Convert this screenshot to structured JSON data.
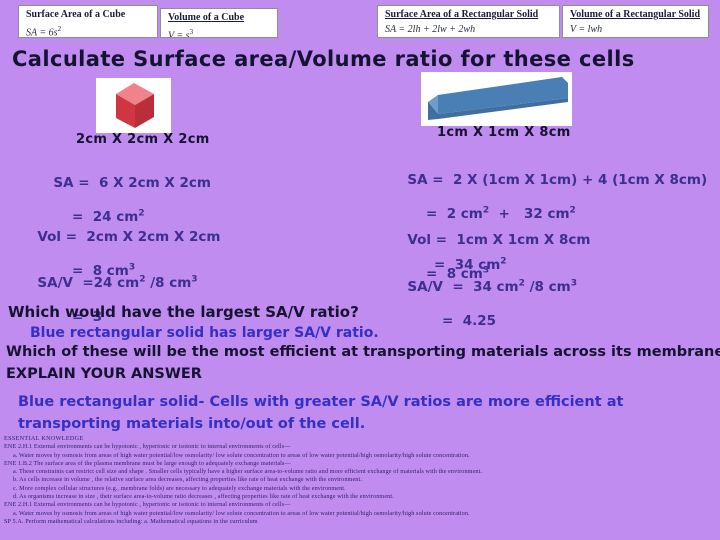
{
  "formula_boxes": [
    {
      "title": "Surface Area of a Cube",
      "equation": "SA = 6s",
      "exponent": "2",
      "underlined": false
    },
    {
      "title": "Volume of a Cube",
      "equation": "V = s",
      "exponent": "3",
      "underlined": true
    },
    {
      "title": "Surface Area of a Rectangular Solid",
      "equation": "SA = 2lh + 2lw + 2wh",
      "exponent": "",
      "underlined": true
    },
    {
      "title": "Volume of a Rectangular Solid",
      "equation": "V = lwh",
      "exponent": "",
      "underlined": true
    }
  ],
  "heading": "Calculate Surface area/Volume ratio for these cells",
  "shapes": {
    "cube": {
      "dimension_caption": "2cm X 2cm X 2cm",
      "top_color": "#f08080",
      "front_color": "#cf3642",
      "side_color": "#c1303c"
    },
    "rect": {
      "dimension_caption": "1cm X 1cm X 8cm",
      "top_color": "#8fb4d8",
      "front_color": "#4a7fb5",
      "side_color": "#6f9cc8"
    }
  },
  "calculations": {
    "left": {
      "sa_line1": "SA =  6 X 2cm X 2cm",
      "sa_line2": "=  24 cm",
      "sa_line2_exp": "2",
      "vol_line1": "Vol =  2cm X 2cm X 2cm",
      "vol_line2": "=  8 cm",
      "vol_line2_exp": "3",
      "sav_line1a": "SA/V  =24 cm",
      "sav_line1a_exp": "2",
      "sav_line1b": " /8 cm",
      "sav_line1b_exp": "3",
      "sav_line2": "=  3"
    },
    "right": {
      "sa_line1": "SA =  2 X (1cm X 1cm) + 4 (1cm X 8cm)",
      "sa_line2a": "=  2 cm",
      "sa_line2a_exp": "2",
      "sa_line2b": "  +   32 cm",
      "sa_line2b_exp": "2",
      "sa_line3": "=  34 cm",
      "sa_line3_exp": "2",
      "vol_line1": "Vol =  1cm X 1cm X 8cm",
      "vol_line2": "=  8 cm",
      "vol_line2_exp": "3",
      "sav_line1a": "SA/V  =  34 cm",
      "sav_line1a_exp": "2",
      "sav_line1b": " /8 cm",
      "sav_line1b_exp": "3",
      "sav_line2": "=  4.25"
    }
  },
  "questions": {
    "q1": "Which would have the largest SA/V ratio?",
    "a1": "Blue rectangular solid has larger SA/V ratio.",
    "q2": "Which of these will be the most efficient at transporting materials across its membrane?",
    "q3": "EXPLAIN YOUR ANSWER",
    "a2": "Blue rectangular solid- Cells with greater SA/V ratios are more efficient at transporting materials into/out of the cell."
  },
  "fineprint": {
    "heading": "ESSENTIAL KNOWLEDGE",
    "lines": [
      {
        "text": "ENE 2.H.1 External environments can be hypotonic , hypertonic or isotonic to internal environments of cells—",
        "sub": false
      },
      {
        "text": "a. Water moves by osmosis from areas of high water potential/low osmolarity/ low solute concentration to areas of low water potential/high osmolarity/high solute concentration.",
        "sub": true
      },
      {
        "text": "ENE 1.B.2  The surface area of the plasma membrane must be large enough to adequately exchange materials—",
        "sub": false
      },
      {
        "text": "a. These constraints can restrict cell size and shape . Smaller cells typically have a higher surface area-to-volume ratio and more efficient exchange of materials with the environment.",
        "sub": true
      },
      {
        "text": "b. As cells increase in volume , the relative surface area decreases, affecting properties like rate of heat exchange with the environment.",
        "sub": true
      },
      {
        "text": "c. More complex cellular structures (e.g., membrane folds) are necessary to adequately exchange materials with the environment.",
        "sub": true
      },
      {
        "text": "d. As organisms increase in size , their surface area-to-volume ratio decreases , affecting properties like rate of heat exchange with the environment.",
        "sub": true
      },
      {
        "text": "ENE 2.H.1 External environments can be hypotonic , hypertonic or isotonic to internal environments of cells—",
        "sub": false
      },
      {
        "text": "a. Water moves by osmosis from areas of high water potential/low osmolarity/ low solute concentration to areas of low water potential/high osmolarity/high solute concentration.",
        "sub": true
      },
      {
        "text": "SP 5.A. Perform mathematical calculations including:     a. Mathematical equations in the curriculum",
        "sub": false
      }
    ]
  }
}
